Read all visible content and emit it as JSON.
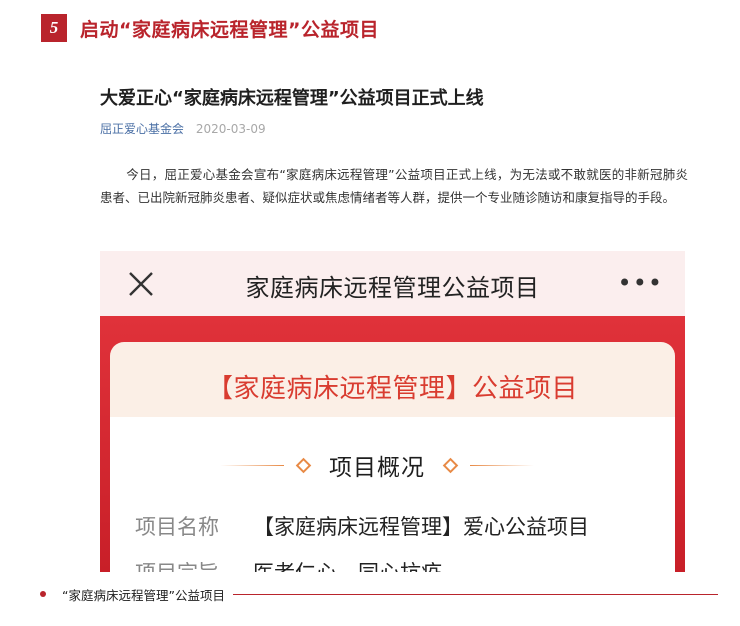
{
  "section": {
    "number": "5",
    "title": "启动“家庭病床远程管理”公益项目"
  },
  "article": {
    "title": "大爱正心“家庭病床远程管理”公益项目正式上线",
    "source": "屈正爱心基金会",
    "date": "2020-03-09",
    "body": "今日，屈正爱心基金会宣布“家庭病床远程管理”公益项目正式上线，为无法或不敢就医的非新冠肺炎患者、已出院新冠肺炎患者、疑似症状或焦虑情绪者等人群，提供一个专业随诊随访和康复指导的手段。"
  },
  "phone": {
    "bar_title": "家庭病床远程管理公益项目",
    "close_icon": "close-icon",
    "more_icon": "more-icon",
    "more_text": "•••",
    "card_title": "【家庭病床远程管理】公益项目",
    "overview_title": "项目概况",
    "fields": [
      {
        "label": "项目名称",
        "value": "【家庭病床远程管理】爱心公益项目"
      },
      {
        "label": "项目宗旨",
        "value": "医者仁心，同心抗疫"
      }
    ]
  },
  "footer": {
    "text": "“家庭病床远程管理”公益项目"
  },
  "colors": {
    "accent": "#b9242c",
    "banner": "#d4262f",
    "card_title": "#d93c30",
    "ornament": "#e88a46",
    "source_link": "#4a6fa5"
  }
}
